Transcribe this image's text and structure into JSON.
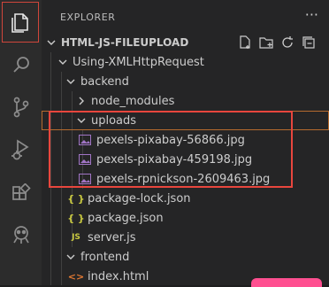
{
  "sidebar": {
    "title": "EXPLORER",
    "more_label": "···",
    "project": "HTML-JS-FILEUPLOAD"
  },
  "activity_bar": {
    "items": [
      "explorer",
      "search",
      "source-control",
      "run-and-debug",
      "extensions",
      "remote"
    ]
  },
  "tree": {
    "using_xhr": "Using-XMLHttpRequest",
    "backend": "backend",
    "node_modules": "node_modules",
    "uploads": "uploads",
    "files": [
      "pexels-pixabay-56866.jpg",
      "pexels-pixabay-459198.jpg",
      "pexels-rpnickson-2609463.jpg"
    ],
    "package_lock": "package-lock.json",
    "package": "package.json",
    "server": "server.js",
    "frontend": "frontend",
    "index": "index.html"
  },
  "icons": {
    "json_glyph": "{ }",
    "js_glyph": "JS",
    "html_glyph": "<>"
  },
  "colors": {
    "highlight_box": "#e8463d",
    "selected_row_outline": "#b66b2e",
    "json_icon": "#cbcb41",
    "js_icon": "#cbcb41",
    "html_icon": "#e37933",
    "image_icon": "#a074c4"
  }
}
